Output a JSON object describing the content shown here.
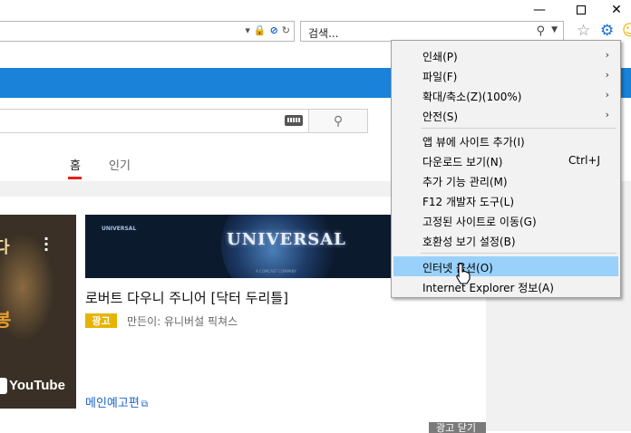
{
  "browser": {
    "search_placeholder": "검색...",
    "window_buttons": {
      "minimize": "—",
      "close": "✕"
    },
    "toolbar_icons": [
      "star-icon",
      "gear-icon",
      "smiley-icon"
    ]
  },
  "page": {
    "tabs": [
      {
        "label": "홈",
        "active": true
      },
      {
        "label": "인기",
        "active": false
      }
    ],
    "ad": {
      "title": "로버트 다우니 주니어 [닥터 두리틀]",
      "badge": "광고",
      "maker": "만든이: 유니버설 픽쳐스",
      "link": "메인예고편",
      "close_label": "광고 닫기",
      "banner_logo": "UNIVERSAL",
      "banner_small_logo": "UNIVERSAL",
      "banner_tagline": "A COMCAST COMPANY",
      "thumb_text_top": "다",
      "thumb_text_bottom": "봉",
      "thumb_youtube": "YouTube"
    },
    "accent_colors": {
      "bluebar": "#1a82d8",
      "tab_underline": "#e62117",
      "badge": "#e6b400",
      "link": "#1a64c8"
    }
  },
  "menu": {
    "items": [
      {
        "label": "인쇄(P)",
        "submenu": true
      },
      {
        "label": "파일(F)",
        "submenu": true
      },
      {
        "label": "확대/축소(Z)(100%)",
        "submenu": true
      },
      {
        "label": "안전(S)",
        "submenu": true
      },
      {
        "label": "앱 뷰에 사이트 추가(I)"
      },
      {
        "label": "다운로드 보기(N)",
        "shortcut": "Ctrl+J"
      },
      {
        "label": "추가 기능 관리(M)"
      },
      {
        "label": "F12 개발자 도구(L)"
      },
      {
        "label": "고정된 사이트로 이동(G)"
      },
      {
        "label": "호환성 보기 설정(B)"
      },
      {
        "label": "인터넷 옵션(O)",
        "highlighted": true
      },
      {
        "label": "Internet Explorer 정보(A)"
      }
    ]
  }
}
